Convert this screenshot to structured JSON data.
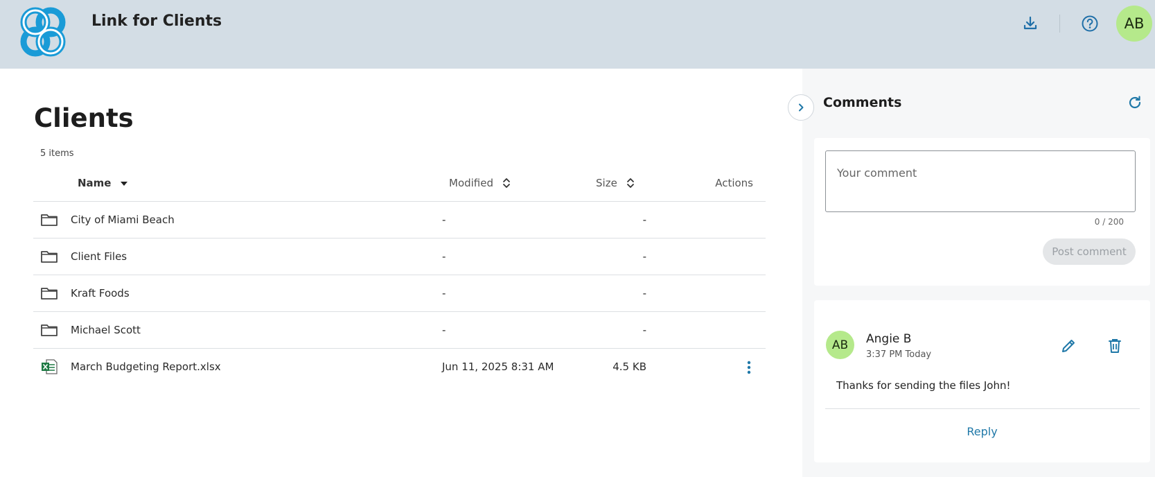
{
  "header": {
    "app_title": "Link for Clients",
    "logo_icon": "sync-logo-icon",
    "download_icon": "download-icon",
    "help_icon": "help-icon",
    "user_initials": "AB",
    "brand_color": "#1a9bd7"
  },
  "main": {
    "page_title": "Clients",
    "item_count": "5 items",
    "columns": {
      "name": "Name",
      "modified": "Modified",
      "size": "Size",
      "actions": "Actions"
    },
    "rows": [
      {
        "type": "folder",
        "name": "City of Miami Beach",
        "modified": "-",
        "size": "-"
      },
      {
        "type": "folder",
        "name": "Client Files",
        "modified": "-",
        "size": "-"
      },
      {
        "type": "folder",
        "name": "Kraft Foods",
        "modified": "-",
        "size": "-"
      },
      {
        "type": "folder",
        "name": "Michael Scott",
        "modified": "-",
        "size": "-"
      },
      {
        "type": "excel",
        "name": "March Budgeting Report.xlsx",
        "modified": "Jun 11, 2025 8:31 AM",
        "size": "4.5 KB"
      }
    ]
  },
  "comments": {
    "title": "Comments",
    "input_placeholder": "Your comment",
    "char_count": "0 / 200",
    "post_label": "Post comment",
    "items": [
      {
        "initials": "AB",
        "author": "Angie B",
        "time": "3:37 PM Today",
        "text": "Thanks for sending the files John!",
        "reply_label": "Reply"
      }
    ]
  }
}
